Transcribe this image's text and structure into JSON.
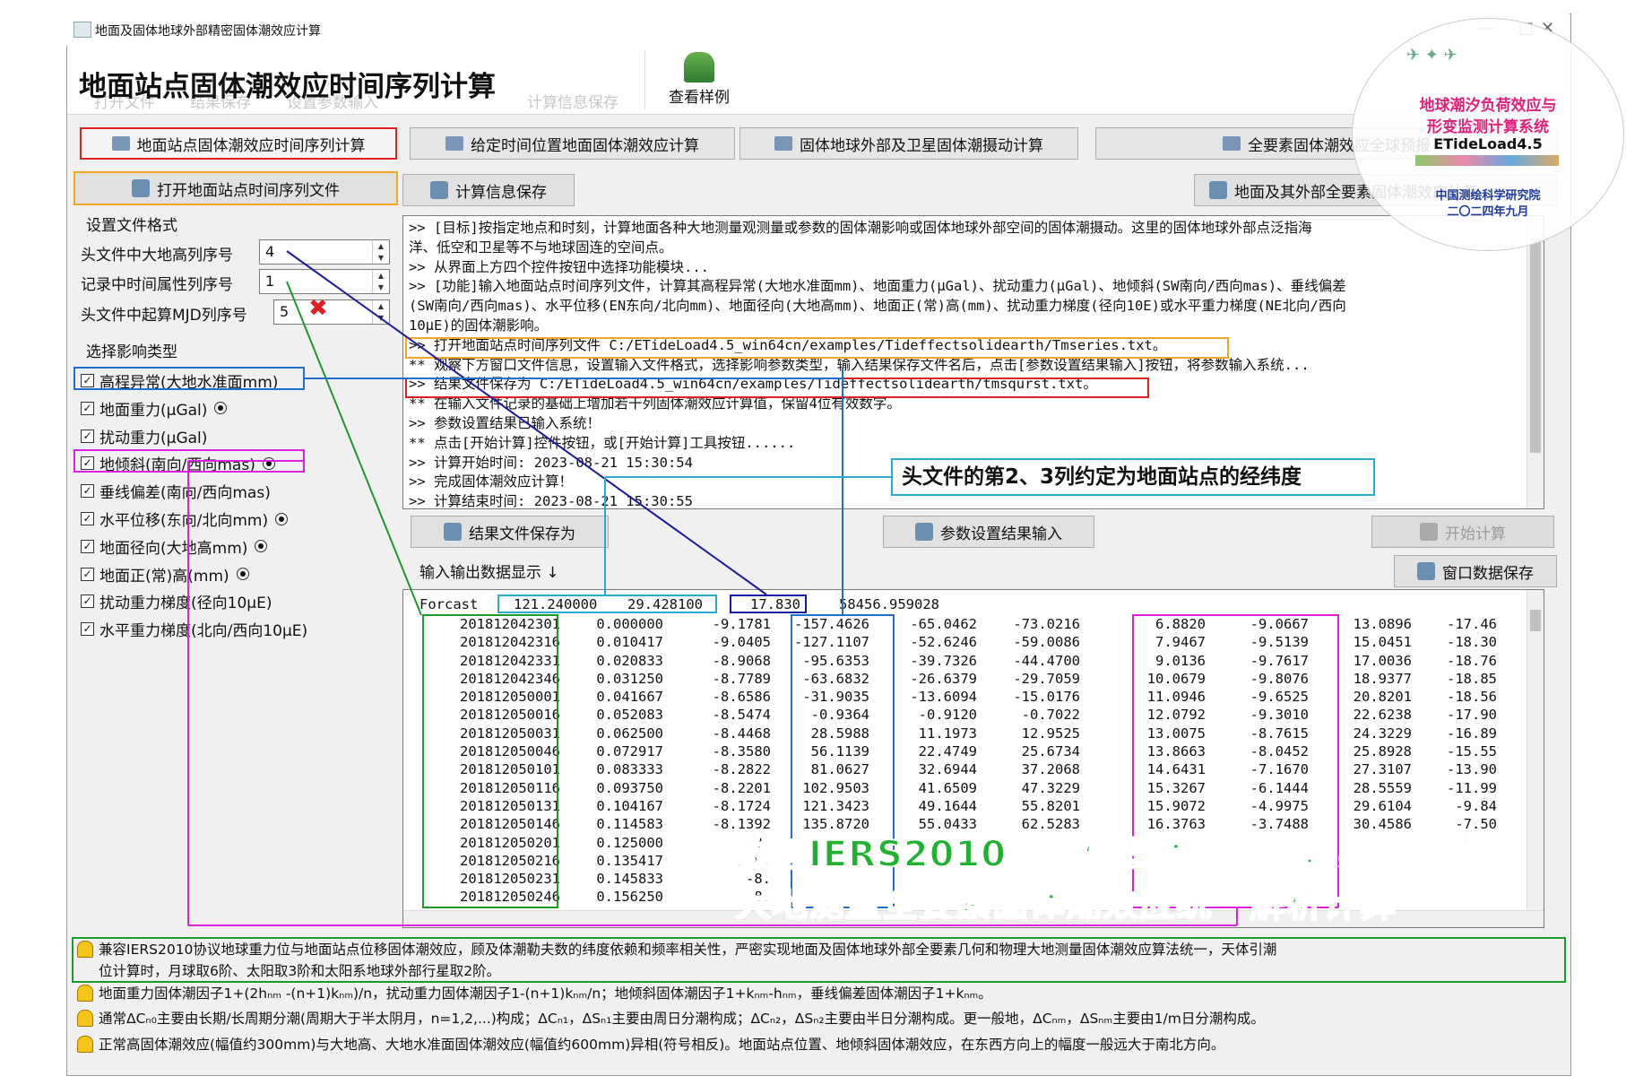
{
  "window": {
    "title": "地面及固体地球外部精密固体潮效应计算",
    "controls": [
      "—",
      "□",
      "✕"
    ]
  },
  "toolbar": {
    "page_title": "地面站点固体潮效应时间序列计算",
    "ghost_items": [
      "打开文件",
      "结果保存",
      "设置参数输入",
      "计算信息保存"
    ],
    "view_example": "查看样例"
  },
  "tabs": [
    "地面站点固体潮效应时间序列计算",
    "给定时间位置地面固体潮效应计算",
    "固体地球外部及卫星固体潮摄动计算",
    "全要素固体潮效应全球预报"
  ],
  "left": {
    "open_button": "打开地面站点时间序列文件",
    "format_group": "设置文件格式",
    "fields": [
      {
        "label": "头文件中大地高列序号",
        "value": "4"
      },
      {
        "label": "记录中时间属性列序号",
        "value": "1"
      },
      {
        "label": "头文件中起算MJD列序号",
        "value": "5"
      }
    ],
    "effect_group": "选择影响类型",
    "checks": [
      {
        "label": "高程异常(大地水准面mm)",
        "radio": false
      },
      {
        "label": "地面重力(μGal)",
        "radio": true
      },
      {
        "label": "扰动重力(μGal)",
        "radio": false
      },
      {
        "label": "地倾斜(南向/西向mas)",
        "radio": true
      },
      {
        "label": "垂线偏差(南向/西向mas)",
        "radio": false
      },
      {
        "label": "水平位移(东向/北向mm)",
        "radio": true
      },
      {
        "label": "地面径向(大地高mm)",
        "radio": true
      },
      {
        "label": "地面正(常)高(mm)",
        "radio": true
      },
      {
        "label": "扰动重力梯度(径向10μE)",
        "radio": false
      },
      {
        "label": "水平重力梯度(北向/西向10μE)",
        "radio": false
      }
    ]
  },
  "right": {
    "save_info_button": "计算信息保存",
    "external_button": "地面及其外部全要素固体潮效应计算",
    "messages": [
      ">> [目标]按指定地点和时刻，计算地面各种大地测量观测量或参数的固体潮影响或固体地球外部空间的固体潮摄动。这里的固体地球外部点泛指海",
      "洋、低空和卫星等不与地球固连的空间点。",
      ">> 从界面上方四个控件按钮中选择功能模块...",
      ">> [功能]输入地面站点时间序列文件，计算其高程异常(大地水准面mm)、地面重力(μGal)、扰动重力(μGal)、地倾斜(SW南向/西向mas)、垂线偏差",
      "(SW南向/西向mas)、水平位移(EN东向/北向mm)、地面径向(大地高mm)、地面正(常)高(mm)、扰动重力梯度(径向10E)或水平重力梯度(NE北向/西向",
      "10μE)的固体潮影响。",
      ">> 打开地面站点时间序列文件 C:/ETideLoad4.5_win64cn/examples/Tideffectsolidearth/Tmseries.txt。",
      "  ** 观察下方窗口文件信息，设置输入文件格式，选择影响参数类型，输入结果保存文件名后，点击[参数设置结果输入]按钮，将参数输入系统...",
      ">> 结果文件保存为 C:/ETideLoad4.5_win64cn/examples/Tideffectsolidearth/tmsqurst.txt。",
      "  ** 在输入文件记录的基础上增加若干列固体潮效应计算值，保留4位有效数字。",
      ">> 参数设置结果已输入系统！",
      "  ** 点击[开始计算]控件按钮，或[开始计算]工具按钮......",
      ">> 计算开始时间: 2023-08-21 15:30:54",
      ">> 完成固体潮效应计算！",
      ">> 计算结束时间: 2023-08-21 15:30:55"
    ],
    "result_save_button": "结果文件保存为",
    "param_button": "参数设置结果输入",
    "start_button": "开始计算",
    "io_label": "输入输出数据显示 ↓",
    "window_save_button": "窗口数据保存",
    "header_row": [
      "Forcast",
      "121.240000",
      "29.428100",
      "17.830",
      "58456.959028"
    ],
    "rows": [
      [
        "201812042301",
        "0.000000",
        "-9.1781",
        "-157.4626",
        "-65.0462",
        "-73.0216",
        "6.8820",
        "-9.0667",
        "13.0896",
        "-17.46"
      ],
      [
        "201812042316",
        "0.010417",
        "-9.0405",
        "-127.1107",
        "-52.6246",
        "-59.0086",
        "7.9467",
        "-9.5139",
        "15.0451",
        "-18.30"
      ],
      [
        "201812042331",
        "0.020833",
        "-8.9068",
        "-95.6353",
        "-39.7326",
        "-44.4700",
        "9.0136",
        "-9.7617",
        "17.0036",
        "-18.76"
      ],
      [
        "201812042346",
        "0.031250",
        "-8.7789",
        "-63.6832",
        "-26.6379",
        "-29.7059",
        "10.0679",
        "-9.8076",
        "18.9377",
        "-18.85"
      ],
      [
        "201812050001",
        "0.041667",
        "-8.6586",
        "-31.9035",
        "-13.6094",
        "-15.0176",
        "11.0946",
        "-9.6525",
        "20.8201",
        "-18.56"
      ],
      [
        "201812050016",
        "0.052083",
        "-8.5474",
        "-0.9364",
        "-0.9120",
        "-0.7022",
        "12.0792",
        "-9.3010",
        "22.6238",
        "-17.90"
      ],
      [
        "201812050031",
        "0.062500",
        "-8.4468",
        "28.5988",
        "11.1973",
        "12.9525",
        "13.0075",
        "-8.7615",
        "24.3229",
        "-16.89"
      ],
      [
        "201812050046",
        "0.072917",
        "-8.3580",
        "56.1139",
        "22.4749",
        "25.6734",
        "13.8663",
        "-8.0452",
        "25.8928",
        "-15.55"
      ],
      [
        "201812050101",
        "0.083333",
        "-8.2822",
        "81.0627",
        "32.6944",
        "37.2068",
        "14.6431",
        "-7.1670",
        "27.3107",
        "-13.90"
      ],
      [
        "201812050116",
        "0.093750",
        "-8.2201",
        "102.9503",
        "41.6509",
        "47.3229",
        "15.3267",
        "-6.1444",
        "28.5559",
        "-11.99"
      ],
      [
        "201812050131",
        "0.104167",
        "-8.1724",
        "121.3423",
        "49.1644",
        "55.8201",
        "15.9072",
        "-4.9975",
        "29.6104",
        "-9.84"
      ],
      [
        "201812050146",
        "0.114583",
        "-8.1392",
        "135.8720",
        "55.0433",
        "62.5283",
        "16.3763",
        "-3.7488",
        "30.4586",
        "-7.50"
      ],
      [
        "201812050201",
        "0.125000",
        "-8.",
        "",
        "",
        "",
        "",
        "",
        "",
        ""
      ],
      [
        "201812050216",
        "0.135417",
        "-8.",
        "",
        "",
        "",
        "",
        "",
        "",
        ""
      ],
      [
        "201812050231",
        "0.145833",
        "-8.",
        "",
        "",
        "",
        "",
        "",
        "",
        ""
      ],
      [
        "201812050246",
        "0.156250",
        "-8.",
        "",
        "",
        "",
        "",
        "",
        "",
        ""
      ]
    ]
  },
  "annotations": {
    "callout": "头文件的第2、3列约定为地面站点的经纬度",
    "banner_line1": "改善IERS2010站坐标固体潮算法，实现全空间",
    "banner_line2": "大地测量全要素固体潮效应统一解析计算"
  },
  "bottom": [
    "兼容IERS2010协议地球重力位与地面站点位移固体潮效应，顾及体潮勒夫数的纬度依赖和频率相关性，严密实现地面及固体地球外部全要素几何和物理大地测量固体潮效应算法统一，天体引潮",
    "位计算时，月球取6阶、太阳取3阶和太阳系地球外部行星取2阶。",
    "地面重力固体潮因子1+(2hₙₘ -(n+1)kₙₘ)/n，扰动重力固体潮因子1-(n+1)kₙₘ/n；地倾斜固体潮因子1+kₙₘ-hₙₘ，垂线偏差固体潮因子1+kₙₘ。",
    "通常ΔCₙ₀主要由长期/长周期分潮(周期大于半太阴月，n=1,2,...)构成；ΔCₙ₁，ΔSₙ₁主要由周日分潮构成；ΔCₙ₂，ΔSₙ₂主要由半日分潮构成。更一般地，ΔCₙₘ，ΔSₙₘ主要由1/m日分潮构成。",
    "正常高固体潮效应(幅值约300mm)与大地高、大地水准面固体潮效应(幅值约600mm)异相(符号相反)。地面站点位置、地倾斜固体潮效应，在东西方向上的幅度一般远大于南北方向。"
  ],
  "stamp": {
    "line1": "地球潮汐负荷效应与",
    "line2": "形变监测计算系统",
    "product": "ETideLoad4.5",
    "org": "中国测绘科学研究院",
    "date": "二〇二四年九月"
  },
  "colors": {
    "orange": "#f5a623",
    "red": "#e02020",
    "blue": "#1f6fd1",
    "magenta": "#e020e0",
    "green": "#1a9a2a",
    "darkblue": "#1a1aa0",
    "cyan": "#2aa8d8",
    "banner": "#1db32e",
    "stamp_red": "#e0207a"
  }
}
